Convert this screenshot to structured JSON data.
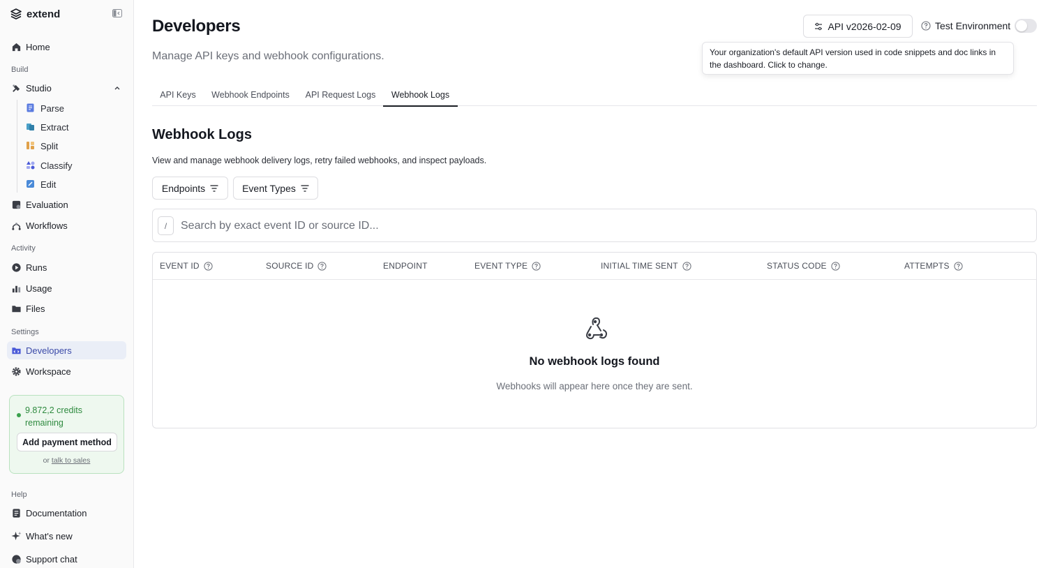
{
  "brand": {
    "name": "extend"
  },
  "sidebar": {
    "home": "Home",
    "sections": {
      "build": "Build",
      "activity": "Activity",
      "settings": "Settings",
      "help": "Help"
    },
    "studio": {
      "label": "Studio",
      "children": [
        "Parse",
        "Extract",
        "Split",
        "Classify",
        "Edit"
      ]
    },
    "evaluation": "Evaluation",
    "workflows": "Workflows",
    "runs": "Runs",
    "usage": "Usage",
    "files": "Files",
    "developers": "Developers",
    "workspace": "Workspace",
    "credits": {
      "text": "9.872,2 credits remaining",
      "button": "Add payment method",
      "or": "or",
      "link": "talk to sales"
    },
    "documentation": "Documentation",
    "whats_new": "What's new",
    "support_chat": "Support chat"
  },
  "header": {
    "title": "Developers",
    "subtitle": "Manage API keys and webhook configurations.",
    "api_version_button": "API v2026-02-09",
    "test_env_label": "Test Environment",
    "test_env_enabled": false,
    "tooltip": "Your organization's default API version used in code snippets and doc links in the dashboard. Click to change."
  },
  "tabs": [
    "API Keys",
    "Webhook Endpoints",
    "API Request Logs",
    "Webhook Logs"
  ],
  "active_tab": "Webhook Logs",
  "content": {
    "title": "Webhook Logs",
    "description": "View and manage webhook delivery logs, retry failed webhooks, and inspect payloads.",
    "filters": {
      "endpoints": "Endpoints",
      "event_types": "Event Types"
    },
    "search": {
      "shortcut": "/",
      "placeholder": "Search by exact event ID or source ID..."
    },
    "columns": [
      "EVENT ID",
      "SOURCE ID",
      "ENDPOINT",
      "EVENT TYPE",
      "INITIAL TIME SENT",
      "STATUS CODE",
      "ATTEMPTS"
    ],
    "empty": {
      "title": "No webhook logs found",
      "subtitle": "Webhooks will appear here once they are sent."
    }
  },
  "colors": {
    "accent": "#3b4aa8",
    "active_bg": "#eaeef7",
    "credits_green": "#2e8a3f"
  }
}
